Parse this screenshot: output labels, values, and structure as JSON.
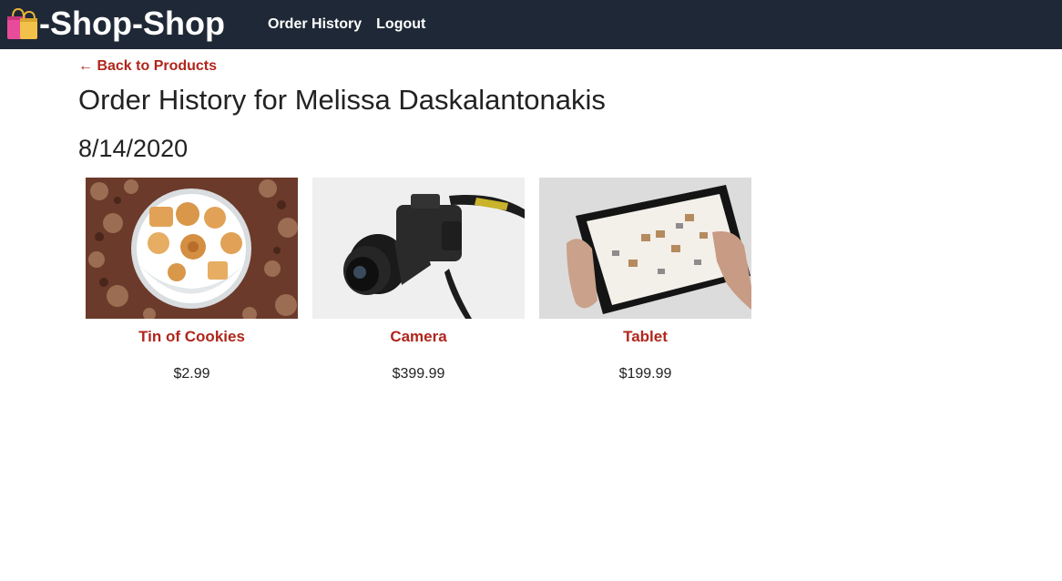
{
  "header": {
    "brand": "-Shop-Shop",
    "brand_icon": "shopping-bags-icon",
    "nav": [
      "Order History",
      "Logout"
    ],
    "background": "#1f2836"
  },
  "back_link": "← Back to Products",
  "page_title": "Order History for Melissa Daskalantonakis",
  "orders": [
    {
      "date": "8/14/2020",
      "items": [
        {
          "name": "Tin of Cookies",
          "price": "$2.99",
          "image": "cookies-tin-photo"
        },
        {
          "name": "Camera",
          "price": "$399.99",
          "image": "dslr-camera-photo"
        },
        {
          "name": "Tablet",
          "price": "$199.99",
          "image": "tablet-in-hands-photo"
        }
      ]
    }
  ],
  "colors": {
    "accent": "#b0261c",
    "navbar": "#1f2836",
    "text": "#222222"
  }
}
